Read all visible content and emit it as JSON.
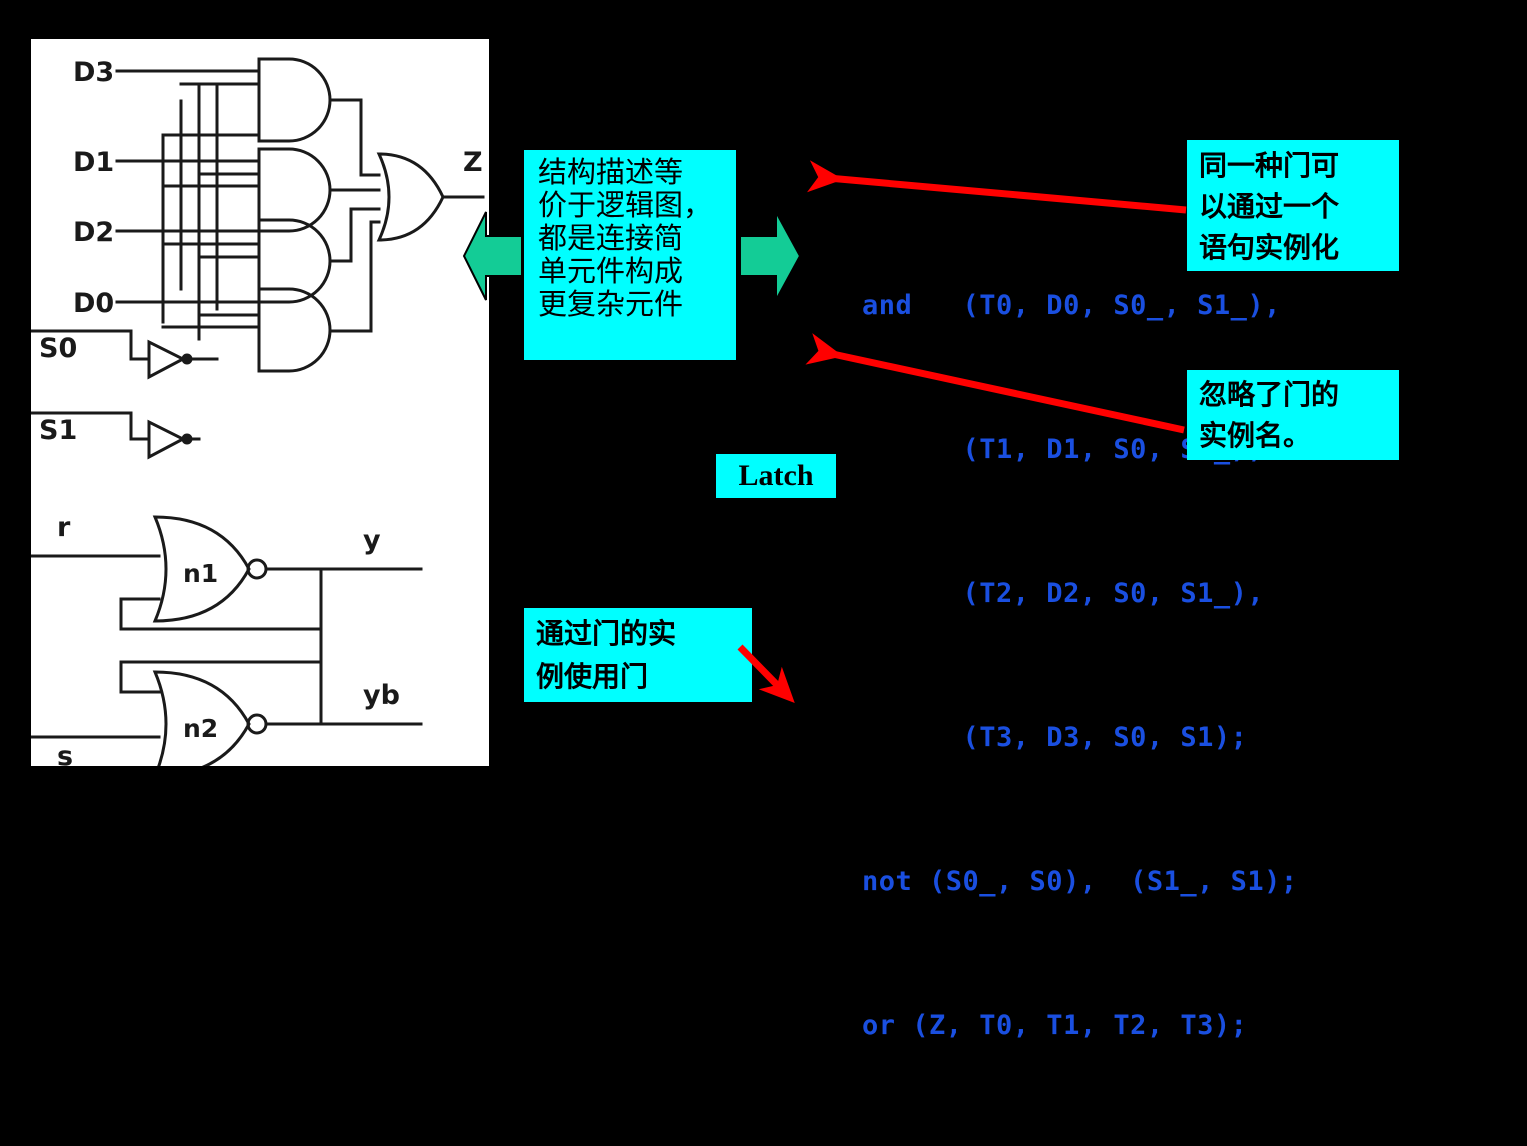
{
  "slide": {
    "background_color": "#000000",
    "accent_cyan": "#00ffff",
    "accent_green": "#13cc96",
    "accent_red": "#ff0000",
    "code_color": "#1a4fe0"
  },
  "figure": {
    "mux_labels": {
      "d3": "D3",
      "d1": "D1",
      "d2": "D2",
      "d0": "D0",
      "s0": "S0",
      "s1": "S1",
      "z": "Z"
    },
    "latch_labels": {
      "r": "r",
      "s": "s",
      "y": "y",
      "yb": "yb",
      "n1": "n1",
      "n2": "n2"
    }
  },
  "callouts": {
    "structure": {
      "lines": [
        "结构描述等",
        "价于逻辑图，",
        "都是连接简",
        "单元件构成",
        "更复杂元件"
      ]
    },
    "same_gate": {
      "lines": [
        "同一种门可",
        "以通过一个",
        "语句实例化"
      ]
    },
    "ignore_name": {
      "lines": [
        "忽略了门的",
        "实例名。"
      ]
    },
    "use_instance": {
      "lines": [
        "通过门的实",
        "例使用门"
      ]
    },
    "latch": {
      "label": "Latch"
    }
  },
  "code": {
    "lines": [
      "and   (T0, D0, S0_, S1_),",
      "      (T1, D1, S0, S1_),",
      "      (T2, D2, S0, S1_),",
      "      (T3, D3, S0, S1);",
      "not (S0_, S0),  (S1_, S1);",
      "or (Z, T0, T1, T2, T3);"
    ]
  }
}
